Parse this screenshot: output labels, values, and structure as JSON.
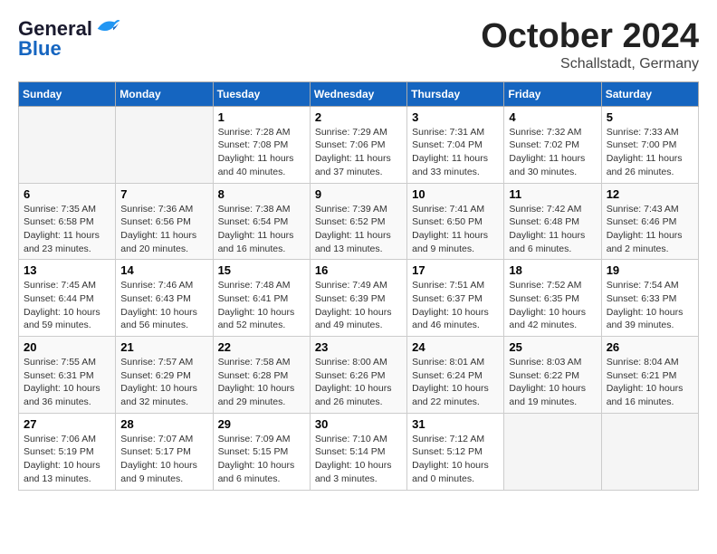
{
  "header": {
    "logo_line1": "General",
    "logo_line2": "Blue",
    "month": "October 2024",
    "location": "Schallstadt, Germany"
  },
  "days_of_week": [
    "Sunday",
    "Monday",
    "Tuesday",
    "Wednesday",
    "Thursday",
    "Friday",
    "Saturday"
  ],
  "weeks": [
    [
      {
        "day": "",
        "info": ""
      },
      {
        "day": "",
        "info": ""
      },
      {
        "day": "1",
        "info": "Sunrise: 7:28 AM\nSunset: 7:08 PM\nDaylight: 11 hours and 40 minutes."
      },
      {
        "day": "2",
        "info": "Sunrise: 7:29 AM\nSunset: 7:06 PM\nDaylight: 11 hours and 37 minutes."
      },
      {
        "day": "3",
        "info": "Sunrise: 7:31 AM\nSunset: 7:04 PM\nDaylight: 11 hours and 33 minutes."
      },
      {
        "day": "4",
        "info": "Sunrise: 7:32 AM\nSunset: 7:02 PM\nDaylight: 11 hours and 30 minutes."
      },
      {
        "day": "5",
        "info": "Sunrise: 7:33 AM\nSunset: 7:00 PM\nDaylight: 11 hours and 26 minutes."
      }
    ],
    [
      {
        "day": "6",
        "info": "Sunrise: 7:35 AM\nSunset: 6:58 PM\nDaylight: 11 hours and 23 minutes."
      },
      {
        "day": "7",
        "info": "Sunrise: 7:36 AM\nSunset: 6:56 PM\nDaylight: 11 hours and 20 minutes."
      },
      {
        "day": "8",
        "info": "Sunrise: 7:38 AM\nSunset: 6:54 PM\nDaylight: 11 hours and 16 minutes."
      },
      {
        "day": "9",
        "info": "Sunrise: 7:39 AM\nSunset: 6:52 PM\nDaylight: 11 hours and 13 minutes."
      },
      {
        "day": "10",
        "info": "Sunrise: 7:41 AM\nSunset: 6:50 PM\nDaylight: 11 hours and 9 minutes."
      },
      {
        "day": "11",
        "info": "Sunrise: 7:42 AM\nSunset: 6:48 PM\nDaylight: 11 hours and 6 minutes."
      },
      {
        "day": "12",
        "info": "Sunrise: 7:43 AM\nSunset: 6:46 PM\nDaylight: 11 hours and 2 minutes."
      }
    ],
    [
      {
        "day": "13",
        "info": "Sunrise: 7:45 AM\nSunset: 6:44 PM\nDaylight: 10 hours and 59 minutes."
      },
      {
        "day": "14",
        "info": "Sunrise: 7:46 AM\nSunset: 6:43 PM\nDaylight: 10 hours and 56 minutes."
      },
      {
        "day": "15",
        "info": "Sunrise: 7:48 AM\nSunset: 6:41 PM\nDaylight: 10 hours and 52 minutes."
      },
      {
        "day": "16",
        "info": "Sunrise: 7:49 AM\nSunset: 6:39 PM\nDaylight: 10 hours and 49 minutes."
      },
      {
        "day": "17",
        "info": "Sunrise: 7:51 AM\nSunset: 6:37 PM\nDaylight: 10 hours and 46 minutes."
      },
      {
        "day": "18",
        "info": "Sunrise: 7:52 AM\nSunset: 6:35 PM\nDaylight: 10 hours and 42 minutes."
      },
      {
        "day": "19",
        "info": "Sunrise: 7:54 AM\nSunset: 6:33 PM\nDaylight: 10 hours and 39 minutes."
      }
    ],
    [
      {
        "day": "20",
        "info": "Sunrise: 7:55 AM\nSunset: 6:31 PM\nDaylight: 10 hours and 36 minutes."
      },
      {
        "day": "21",
        "info": "Sunrise: 7:57 AM\nSunset: 6:29 PM\nDaylight: 10 hours and 32 minutes."
      },
      {
        "day": "22",
        "info": "Sunrise: 7:58 AM\nSunset: 6:28 PM\nDaylight: 10 hours and 29 minutes."
      },
      {
        "day": "23",
        "info": "Sunrise: 8:00 AM\nSunset: 6:26 PM\nDaylight: 10 hours and 26 minutes."
      },
      {
        "day": "24",
        "info": "Sunrise: 8:01 AM\nSunset: 6:24 PM\nDaylight: 10 hours and 22 minutes."
      },
      {
        "day": "25",
        "info": "Sunrise: 8:03 AM\nSunset: 6:22 PM\nDaylight: 10 hours and 19 minutes."
      },
      {
        "day": "26",
        "info": "Sunrise: 8:04 AM\nSunset: 6:21 PM\nDaylight: 10 hours and 16 minutes."
      }
    ],
    [
      {
        "day": "27",
        "info": "Sunrise: 7:06 AM\nSunset: 5:19 PM\nDaylight: 10 hours and 13 minutes."
      },
      {
        "day": "28",
        "info": "Sunrise: 7:07 AM\nSunset: 5:17 PM\nDaylight: 10 hours and 9 minutes."
      },
      {
        "day": "29",
        "info": "Sunrise: 7:09 AM\nSunset: 5:15 PM\nDaylight: 10 hours and 6 minutes."
      },
      {
        "day": "30",
        "info": "Sunrise: 7:10 AM\nSunset: 5:14 PM\nDaylight: 10 hours and 3 minutes."
      },
      {
        "day": "31",
        "info": "Sunrise: 7:12 AM\nSunset: 5:12 PM\nDaylight: 10 hours and 0 minutes."
      },
      {
        "day": "",
        "info": ""
      },
      {
        "day": "",
        "info": ""
      }
    ]
  ]
}
